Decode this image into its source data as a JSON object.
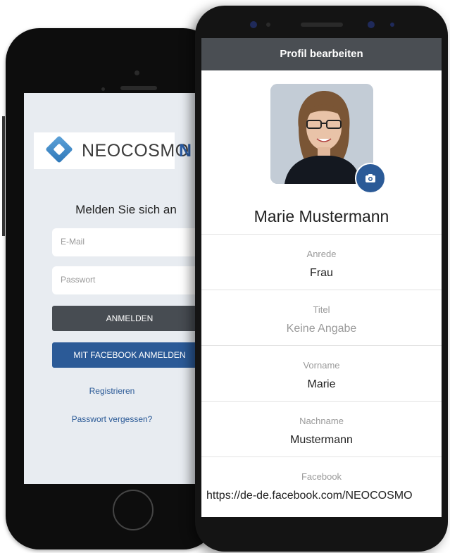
{
  "login_screen": {
    "logo_text": "NEOCOSMO",
    "logo_overflow": "N",
    "title": "Melden Sie sich an",
    "email_placeholder": "E-Mail",
    "password_placeholder": "Passwort",
    "login_button": "ANMELDEN",
    "facebook_button": "MIT FACEBOOK ANMELDEN",
    "register_link": "Registrieren",
    "forgot_password_link": "Passwort vergessen?"
  },
  "profile_screen": {
    "header_title": "Profil bearbeiten",
    "name": "Marie Mustermann",
    "fields": [
      {
        "label": "Anrede",
        "value": "Frau"
      },
      {
        "label": "Titel",
        "value": "Keine Angabe"
      },
      {
        "label": "Vorname",
        "value": "Marie"
      },
      {
        "label": "Nachname",
        "value": "Mustermann"
      },
      {
        "label": "Facebook",
        "value": "https://de-de.facebook.com/NEOCOSMO"
      }
    ]
  },
  "colors": {
    "brand_blue": "#2b5a97",
    "header_gray": "#4a4e53",
    "login_button_gray": "#474c52"
  },
  "icons": {
    "camera": "camera-icon",
    "logo": "neocosmo-logo-icon"
  }
}
